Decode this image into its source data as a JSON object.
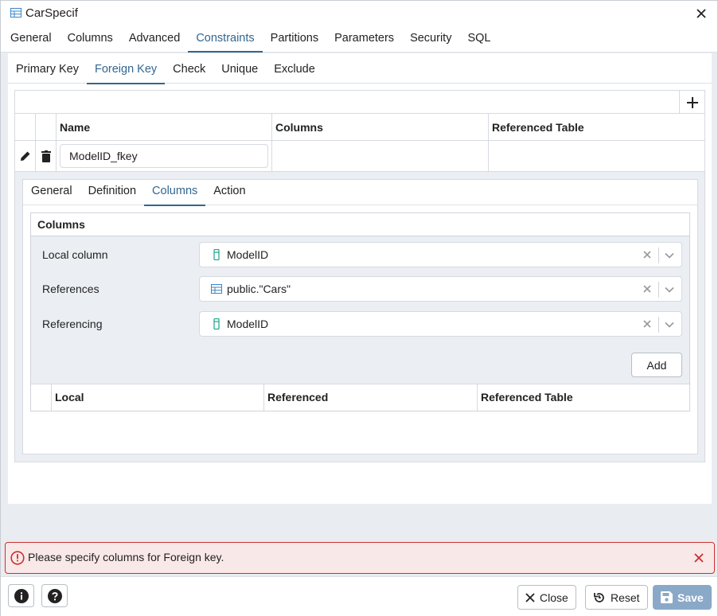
{
  "window": {
    "title": "CarSpecif",
    "table_icon": "table-icon",
    "close_icon": "close-icon"
  },
  "main_tabs": [
    {
      "label": "General"
    },
    {
      "label": "Columns"
    },
    {
      "label": "Advanced"
    },
    {
      "label": "Constraints",
      "active": true
    },
    {
      "label": "Partitions"
    },
    {
      "label": "Parameters"
    },
    {
      "label": "Security"
    },
    {
      "label": "SQL"
    }
  ],
  "sub_tabs": [
    {
      "label": "Primary Key"
    },
    {
      "label": "Foreign Key",
      "active": true
    },
    {
      "label": "Check"
    },
    {
      "label": "Unique"
    },
    {
      "label": "Exclude"
    }
  ],
  "fk_grid": {
    "headers": {
      "name": "Name",
      "columns": "Columns",
      "referenced_table": "Referenced Table"
    },
    "row": {
      "name": "ModelID_fkey",
      "columns": "",
      "referenced_table": ""
    }
  },
  "detail_tabs": [
    {
      "label": "General"
    },
    {
      "label": "Definition"
    },
    {
      "label": "Columns",
      "active": true
    },
    {
      "label": "Action"
    }
  ],
  "columns_section": {
    "title": "Columns",
    "local_column": {
      "label": "Local column",
      "value": "ModelID",
      "icon": "column-icon"
    },
    "references": {
      "label": "References",
      "value": "public.\"Cars\"",
      "icon": "table-icon"
    },
    "referencing": {
      "label": "Referencing",
      "value": "ModelID",
      "icon": "column-icon"
    },
    "add_label": "Add",
    "table_headers": {
      "local": "Local",
      "referenced": "Referenced",
      "referenced_table": "Referenced Table"
    }
  },
  "error": {
    "message": "Please specify columns for Foreign key."
  },
  "footer": {
    "close_label": "Close",
    "reset_label": "Reset",
    "save_label": "Save"
  },
  "colors": {
    "accent": "#326690",
    "error_border": "#cc2f2f",
    "error_bg": "#f9e8e8",
    "save_bg": "#8aa9c8",
    "column_icon": "#1aa38a"
  }
}
